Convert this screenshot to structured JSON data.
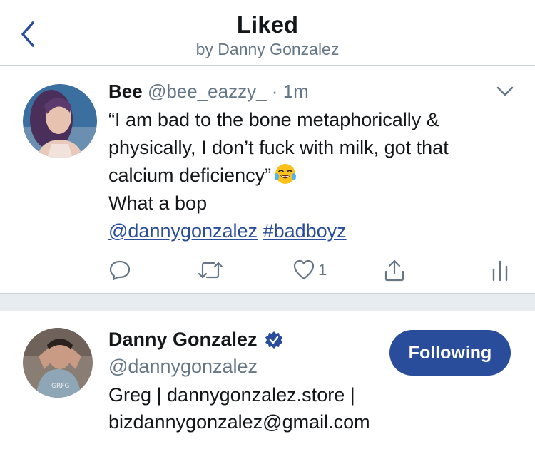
{
  "header": {
    "title": "Liked",
    "subtitle": "by Danny Gonzalez"
  },
  "tweet": {
    "name": "Bee",
    "handle": "@bee_eazzy_",
    "dot": "·",
    "time": "1m",
    "body_lines": [
      "“I am bad to the bone metaphorically &",
      "physically, I don’t fuck with milk, got that",
      "calcium deficiency”"
    ],
    "comment": "What a bop",
    "mention": "@dannygonzalez",
    "hashtag": "#badboyz",
    "like_count": "1"
  },
  "user": {
    "name": "Danny Gonzalez",
    "handle": "@dannygonzalez",
    "bio_line1": "Greg | dannygonzalez.store |",
    "bio_line2": "bizdannygonzalez@gmail.com",
    "follow_label": "Following"
  },
  "colors": {
    "accent": "#2a4d9b",
    "muted": "#657786",
    "separator": "#e6ecf0"
  }
}
